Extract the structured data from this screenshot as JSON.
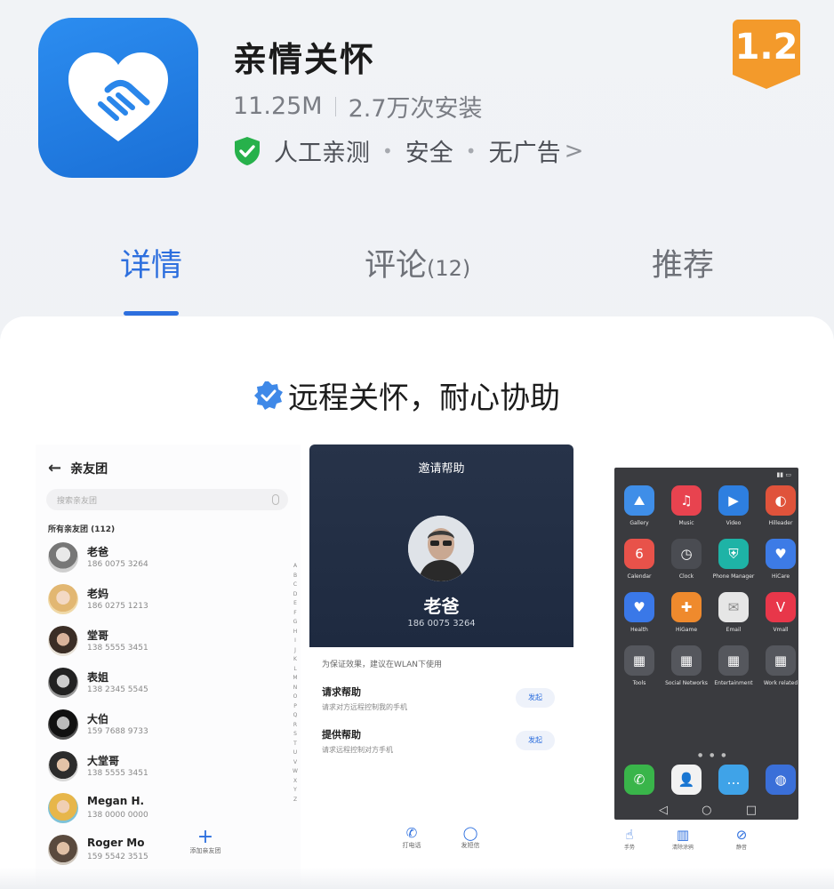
{
  "app": {
    "name": "亲情关怀",
    "size": "11.25M",
    "installs": "2.7万次安装",
    "badges": [
      "人工亲测",
      "安全",
      "无广告"
    ],
    "rating": "1.2"
  },
  "tabs": [
    {
      "label": "详情",
      "count": ""
    },
    {
      "label": "评论",
      "count": "(12)"
    },
    {
      "label": "推荐",
      "count": ""
    }
  ],
  "slogan": "远程关怀，耐心协助",
  "screen1": {
    "title": "亲友团",
    "search_placeholder": "搜索亲友团",
    "group_label": "所有亲友团 (112)",
    "contacts": [
      {
        "name": "老爸",
        "phone": "186 0075 3264"
      },
      {
        "name": "老妈",
        "phone": "186 0275 1213"
      },
      {
        "name": "堂哥",
        "phone": "138 5555 3451"
      },
      {
        "name": "表姐",
        "phone": "138 2345 5545"
      },
      {
        "name": "大伯",
        "phone": "159 7688 9733"
      },
      {
        "name": "大堂哥",
        "phone": "138 5555 3451"
      },
      {
        "name": "Megan H.",
        "phone": "138 0000 0000"
      },
      {
        "name": "Roger Mo",
        "phone": "159 5542 3515"
      }
    ],
    "alphabet": "ABCDEFGHIJKLMNOPQRSTUVWXYZ",
    "add_label": "添加亲友团"
  },
  "screen2": {
    "title": "邀请帮助",
    "contact_name": "老爸",
    "contact_phone": "186 0075 3264",
    "tip": "为保证效果，建议在WLAN下使用",
    "options": [
      {
        "title": "请求帮助",
        "subtitle": "请求对方远程控制我的手机",
        "button": "发起"
      },
      {
        "title": "提供帮助",
        "subtitle": "请求远程控制对方手机",
        "button": "发起"
      }
    ],
    "bottom": [
      {
        "icon": "phone-icon",
        "label": "打电话"
      },
      {
        "icon": "message-icon",
        "label": "发短信"
      }
    ]
  },
  "screen3": {
    "apps": [
      {
        "label": "Gallery",
        "icon": "gallery-icon",
        "color": "#3f8ee8"
      },
      {
        "label": "Music",
        "icon": "music-icon",
        "color": "#e8434f"
      },
      {
        "label": "Video",
        "icon": "video-icon",
        "color": "#2e7fe0"
      },
      {
        "label": "Hilleader",
        "icon": "hilleader-icon",
        "color": "#e0533b"
      },
      {
        "label": "Calendar",
        "icon": "calendar-icon",
        "color": "#e8524a"
      },
      {
        "label": "Clock",
        "icon": "clock-icon",
        "color": "#4a4c52"
      },
      {
        "label": "Phone Manager",
        "icon": "phone-manager-icon",
        "color": "#1eb3a6"
      },
      {
        "label": "HiCare",
        "icon": "hicare-icon",
        "color": "#3d7be6"
      },
      {
        "label": "Health",
        "icon": "health-icon",
        "color": "#3a78e8"
      },
      {
        "label": "HiGame",
        "icon": "higame-icon",
        "color": "#ef8a2d"
      },
      {
        "label": "Email",
        "icon": "email-icon",
        "color": "#e6e6e6"
      },
      {
        "label": "Vmall",
        "icon": "vmall-icon",
        "color": "#e8374a"
      },
      {
        "label": "Tools",
        "icon": "tools-folder-icon",
        "color": "#55575d"
      },
      {
        "label": "Social Networks",
        "icon": "social-folder-icon",
        "color": "#55575d"
      },
      {
        "label": "Entertainment",
        "icon": "entertainment-folder-icon",
        "color": "#55575d"
      },
      {
        "label": "Work related",
        "icon": "work-folder-icon",
        "color": "#55575d"
      }
    ],
    "dock": [
      {
        "icon": "phone-icon",
        "color": "#39b54a"
      },
      {
        "icon": "contacts-icon",
        "color": "#f2f2f2"
      },
      {
        "icon": "messages-icon",
        "color": "#3fa3e8"
      },
      {
        "icon": "browser-icon",
        "color": "#3a6fd8"
      }
    ],
    "bottom": [
      {
        "icon": "gesture-icon",
        "label": "手势"
      },
      {
        "icon": "trash-icon",
        "label": "清除涂鸦"
      },
      {
        "icon": "mic-off-icon",
        "label": "静音"
      }
    ]
  },
  "colors": {
    "accent": "#2d6fde",
    "rating_badge": "#f39a2b",
    "shield": "#27b14b"
  }
}
